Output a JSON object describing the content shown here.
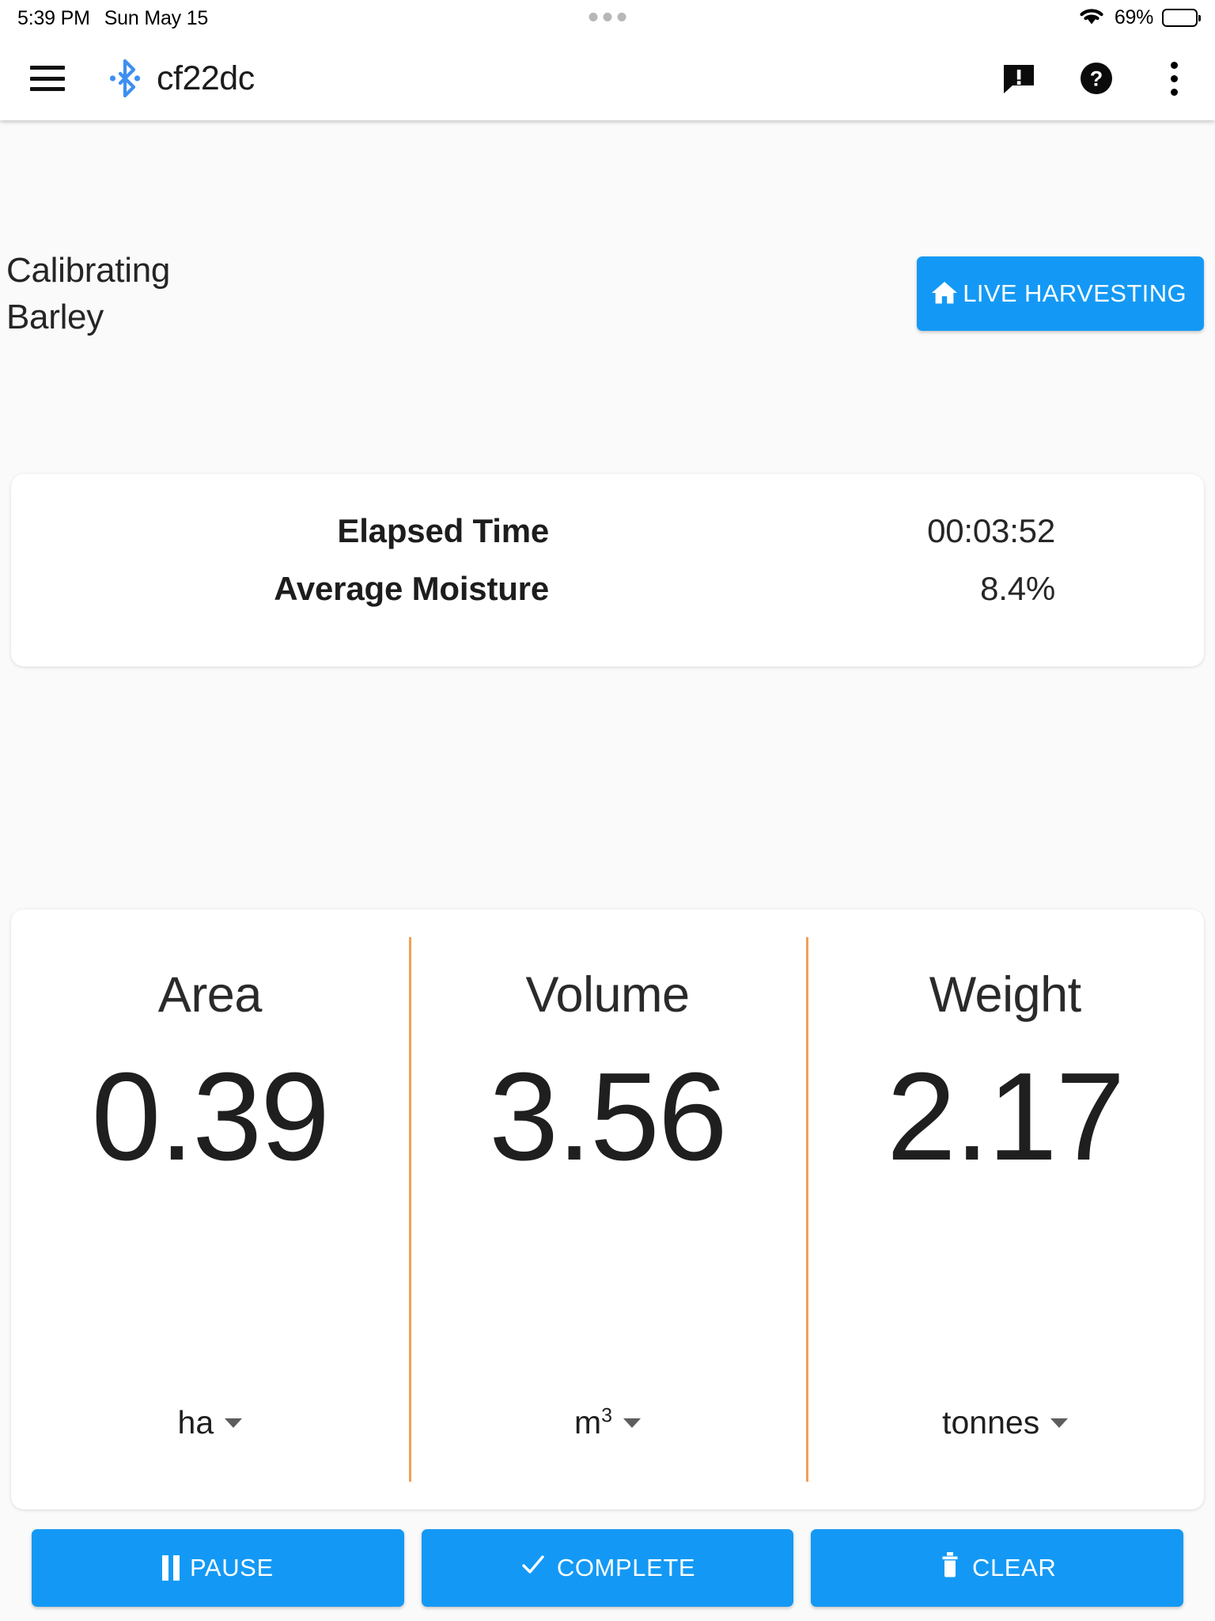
{
  "status_bar": {
    "time": "5:39 PM",
    "date": "Sun May 15",
    "battery_percent": "69%",
    "wifi_icon": "wifi-icon",
    "battery_icon": "battery-icon",
    "handoff_dots": "three-dots-indicator"
  },
  "app_bar": {
    "menu_icon": "hamburger-menu-icon",
    "bluetooth_icon": "bluetooth-connected-icon",
    "device_name": "cf22dc",
    "actions": [
      {
        "name": "feedback-icon",
        "label": "Feedback"
      },
      {
        "name": "help-icon",
        "label": "Help"
      },
      {
        "name": "overflow-menu-icon",
        "label": "More options"
      }
    ]
  },
  "header": {
    "title_line1": "Calibrating",
    "title_line2": "Barley",
    "live_button": {
      "label": "LIVE HARVESTING",
      "icon": "home-icon",
      "color": "#1399f5"
    }
  },
  "summary": {
    "rows": [
      {
        "label": "Elapsed Time",
        "value": "00:03:52"
      },
      {
        "label": "Average Moisture",
        "value": "8.4%"
      }
    ]
  },
  "metrics": {
    "divider_color": "#f0a055",
    "columns": [
      {
        "title": "Area",
        "value": "0.39",
        "unit": "ha",
        "unit_sup": ""
      },
      {
        "title": "Volume",
        "value": "3.56",
        "unit": "m",
        "unit_sup": "3"
      },
      {
        "title": "Weight",
        "value": "2.17",
        "unit": "tonnes",
        "unit_sup": ""
      }
    ]
  },
  "actions": {
    "buttons": [
      {
        "label": "PAUSE",
        "icon": "pause-icon"
      },
      {
        "label": "COMPLETE",
        "icon": "check-icon"
      },
      {
        "label": "CLEAR",
        "icon": "trash-icon"
      }
    ],
    "color": "#1399f5"
  }
}
